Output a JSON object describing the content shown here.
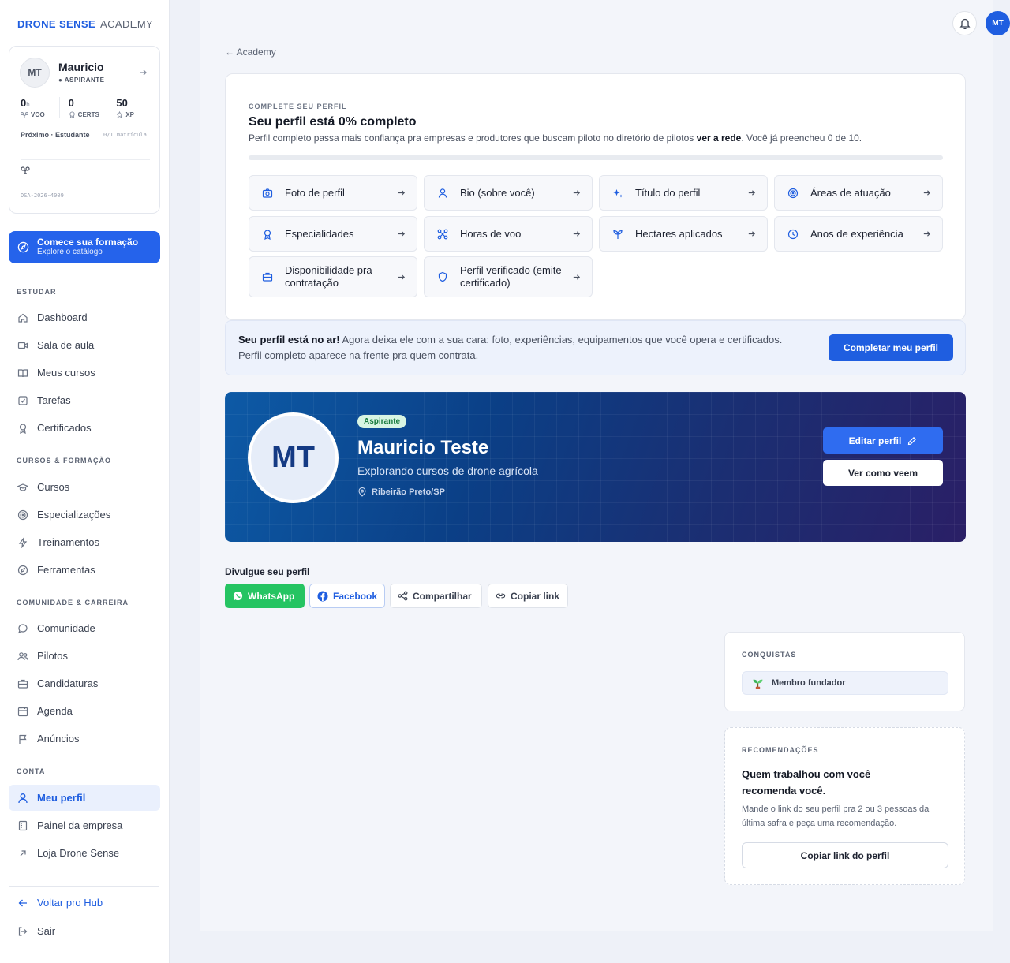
{
  "brand": {
    "primary": "DRONE SENSE",
    "secondary": "ACADEMY"
  },
  "user": {
    "initials": "MT",
    "name": "Mauricio",
    "role": "● ASPIRANTE",
    "stats": [
      {
        "value": "0",
        "unit": "h",
        "label": "VOO"
      },
      {
        "value": "0",
        "unit": "",
        "label": "CERTS"
      },
      {
        "value": "50",
        "unit": "",
        "label": "XP"
      }
    ],
    "next": "Próximo · Estudante",
    "next_meta": "0/1 matrícula",
    "code": "DSA-2026-4009"
  },
  "cta": {
    "title": "Comece sua formação",
    "subtitle": "Explore o catálogo"
  },
  "nav": {
    "estudar": {
      "title": "ESTUDAR",
      "items": [
        "Dashboard",
        "Sala de aula",
        "Meus cursos",
        "Tarefas",
        "Certificados"
      ]
    },
    "cursos": {
      "title": "CURSOS & FORMAÇÃO",
      "items": [
        "Cursos",
        "Especializações",
        "Treinamentos",
        "Ferramentas"
      ]
    },
    "comunidade": {
      "title": "COMUNIDADE & CARREIRA",
      "items": [
        "Comunidade",
        "Pilotos",
        "Candidaturas",
        "Agenda",
        "Anúncios"
      ]
    },
    "conta": {
      "title": "CONTA",
      "items": [
        "Meu perfil",
        "Painel da empresa",
        "Loja Drone Sense"
      ]
    },
    "footer": [
      "Voltar pro Hub",
      "Sair"
    ]
  },
  "topbar": {
    "avatar": "MT"
  },
  "breadcrumb": "← Academy",
  "profile_card": {
    "kicker": "COMPLETE SEU PERFIL",
    "title": "Seu perfil está 0% completo",
    "desc_before": "Perfil completo passa mais confiança pra empresas e produtores que buscam piloto no diretório de pilotos ",
    "desc_bold": "ver a rede",
    "desc_after": ". Você já preencheu 0 de 10.",
    "progress": 0,
    "steps": [
      "Foto de perfil",
      "Bio (sobre você)",
      "Título do perfil",
      "Áreas de atuação",
      "Especialidades",
      "Horas de voo",
      "Hectares aplicados",
      "Anos de experiência",
      "Disponibilidade pra contratação",
      "Perfil verificado (emite certificado)"
    ]
  },
  "banner": {
    "bold": "Seu perfil está no ar!",
    "text": " Agora deixa ele com a sua cara: foto, experiências, equipamentos que você opera e certificados. Perfil completo aparece na frente pra quem contrata.",
    "button": "Completar meu perfil"
  },
  "hero": {
    "initials": "MT",
    "badge": "Aspirante",
    "name": "Mauricio Teste",
    "subtitle": "Explorando cursos de drone agrícola",
    "location": "Ribeirão Preto/SP",
    "edit_button": "Editar perfil",
    "view_button": "Ver como veem"
  },
  "share": {
    "title": "Divulgue seu perfil",
    "whatsapp": "WhatsApp",
    "facebook": "Facebook",
    "share": "Compartilhar",
    "copy": "Copiar link"
  },
  "conquistas": {
    "title": "CONQUISTAS",
    "badge": "Membro fundador"
  },
  "recomendacoes": {
    "title": "RECOMENDAÇÕES",
    "heading": "Quem trabalhou com você recomenda você.",
    "text": "Mande o link do seu perfil pra 2 ou 3 pessoas da última safra e peça uma recomendação.",
    "button": "Copiar link do perfil"
  },
  "colors": {
    "accent": "#1f5ee0",
    "whatsapp": "#25c462",
    "hero_start": "#0d5aa6",
    "hero_end": "#2a1f66"
  }
}
